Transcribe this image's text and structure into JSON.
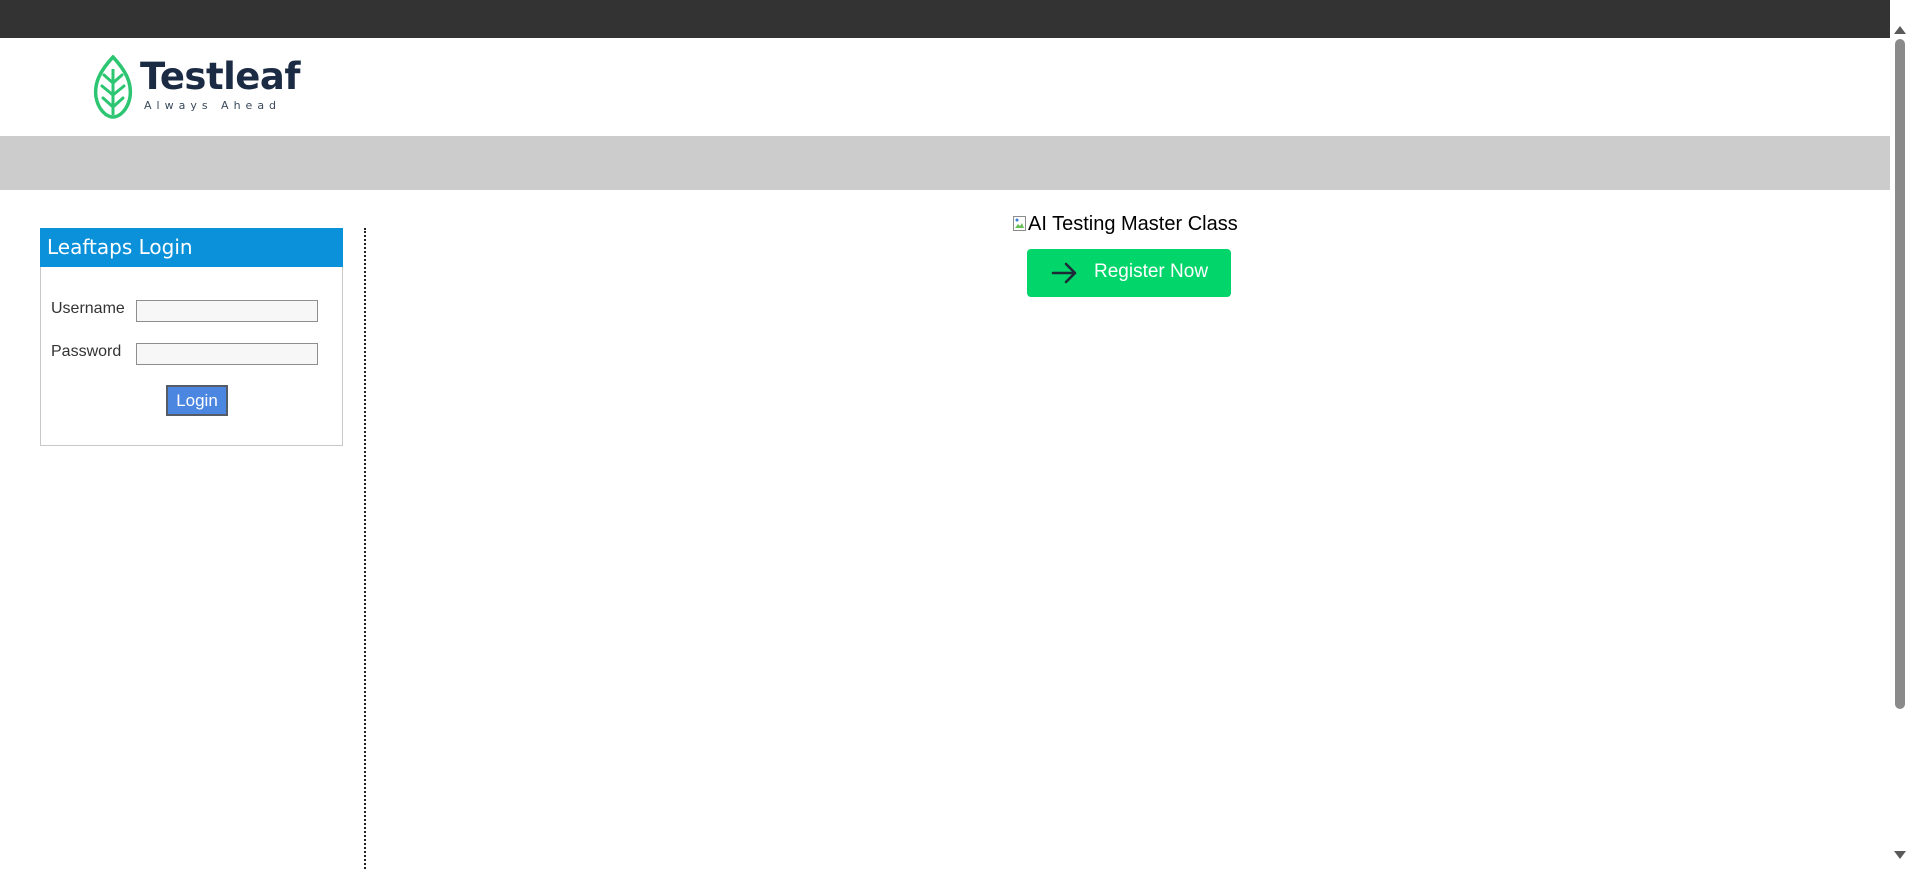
{
  "brand": {
    "name": "Testleaf",
    "tagline": "Always Ahead",
    "logo_icon": "leaf-logo-icon",
    "colors": {
      "leaf": "#2cc672",
      "text": "#1b2b44"
    }
  },
  "login": {
    "title": "Leaftaps Login",
    "username_label": "Username",
    "username_value": "",
    "password_label": "Password",
    "password_value": "",
    "login_button": "Login",
    "colors": {
      "title_bg": "#0a91d9",
      "button_bg": "#4b86e0"
    }
  },
  "promo": {
    "image_alt": "AI Testing Master Class",
    "register_button": "Register Now",
    "register_icon": "arrow-right-icon",
    "colors": {
      "button_bg": "#02d56a"
    }
  },
  "theme": {
    "top_bar": "#333333",
    "nav_band": "#cccccc"
  }
}
